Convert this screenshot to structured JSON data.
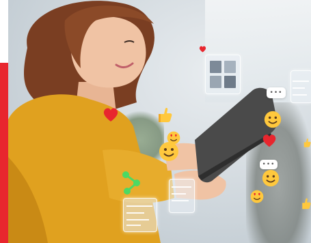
{
  "scene": {
    "description_colors": {
      "accent": "#e8262e",
      "sweater": "#e0a11f",
      "hair": "#7a3e22",
      "skin": "#f0c3a4",
      "tablet": "#4a4a4a",
      "emoji_face": "#ffc83d",
      "heart": "#e8262e"
    },
    "icons": [
      "photo-gallery-icon",
      "chat-bubble-icon",
      "heart-icon",
      "thumbs-up-icon",
      "smiley-emoji-icon",
      "heart-eyes-emoji-icon",
      "share-network-icon",
      "settings-panel-icon"
    ]
  }
}
